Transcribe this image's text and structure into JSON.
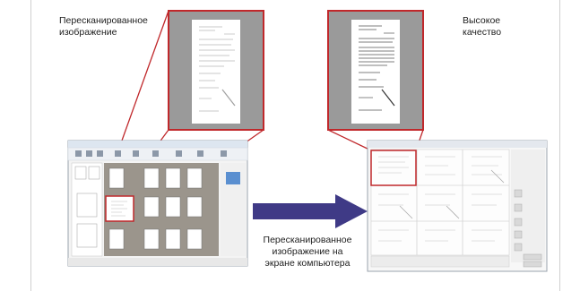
{
  "labels": {
    "rescanned": "Пересканированное\nизображение",
    "high_quality": "Высокое\nкачество",
    "on_screen": "Пересканированное\nизображение на\nэкране компьютера"
  },
  "colors": {
    "highlight": "#c0282b",
    "arrow": "#3f3a86",
    "zoom_bg": "#9a9a9a",
    "window_bg": "#f4f4f4",
    "thumb_area": "#9b958c"
  },
  "icons": {
    "arrow": "right-arrow"
  }
}
